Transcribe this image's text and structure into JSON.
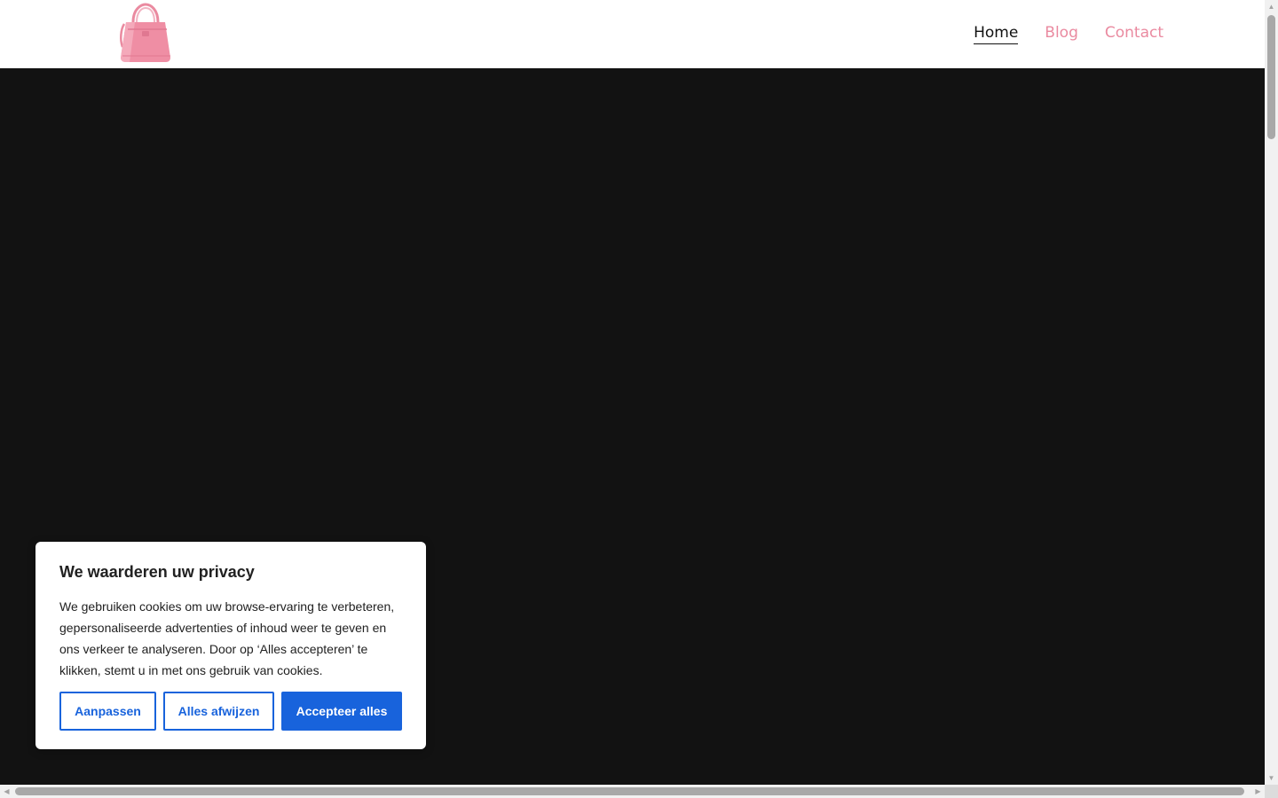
{
  "header": {
    "logo_icon": "handbag-icon",
    "brand_color": "#ea8aa0",
    "nav": [
      {
        "label": "Home",
        "active": true
      },
      {
        "label": "Blog",
        "active": false
      },
      {
        "label": "Contact",
        "active": false
      }
    ]
  },
  "hero": {
    "background_color": "#121212"
  },
  "cookie_banner": {
    "title": "We waarderen uw privacy",
    "body": "We gebruiken cookies om uw browse-ervaring te verbeteren, gepersonaliseerde advertenties of inhoud weer te geven en ons verkeer te analyseren. Door op ‘Alles accepteren’ te klikken, stemt u in met ons gebruik van cookies.",
    "buttons": {
      "customize": "Aanpassen",
      "reject_all": "Alles afwijzen",
      "accept_all": "Accepteer alles"
    },
    "accent_color": "#1863dc"
  },
  "scrollbars": {
    "up_arrow": "▲",
    "down_arrow": "▼",
    "left_arrow": "◀",
    "right_arrow": "▶"
  }
}
